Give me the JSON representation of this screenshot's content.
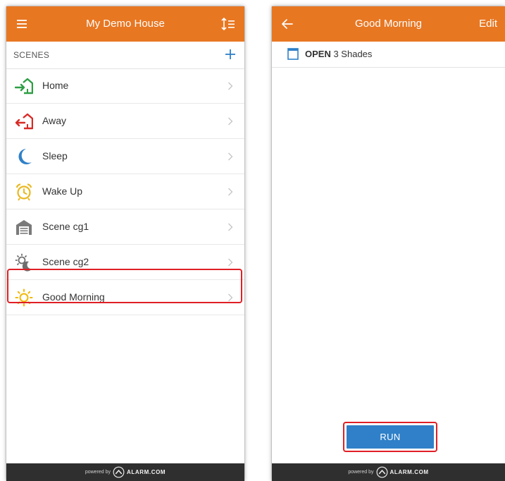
{
  "left_screen": {
    "header": {
      "title": "My Demo House",
      "menu_icon": "hamburger-icon",
      "sort_icon": "sort-icon"
    },
    "section": {
      "label": "SCENES",
      "add_icon": "plus-icon"
    },
    "scenes": [
      {
        "label": "Home",
        "icon": "home-arrive-icon"
      },
      {
        "label": "Away",
        "icon": "home-leave-icon"
      },
      {
        "label": "Sleep",
        "icon": "moon-icon"
      },
      {
        "label": "Wake Up",
        "icon": "alarm-clock-icon"
      },
      {
        "label": "Scene cg1",
        "icon": "garage-icon"
      },
      {
        "label": "Scene cg2",
        "icon": "sun-moon-icon"
      },
      {
        "label": "Good Morning",
        "icon": "sun-icon"
      }
    ],
    "highlighted_scene": "Good Morning",
    "footer": {
      "powered_by": "powered by",
      "brand": "ALARM.COM"
    }
  },
  "right_screen": {
    "header": {
      "title": "Good Morning",
      "back_icon": "arrow-left-icon",
      "edit_label": "Edit"
    },
    "action": {
      "verb": "OPEN",
      "target": "3 Shades",
      "icon": "shade-icon"
    },
    "run_label": "RUN",
    "footer": {
      "powered_by": "powered by",
      "brand": "ALARM.COM"
    }
  },
  "colors": {
    "header_orange": "#e87722",
    "run_blue": "#2f80c8",
    "highlight_red": "#e01f26",
    "footer_dark": "#2f2f2f"
  }
}
